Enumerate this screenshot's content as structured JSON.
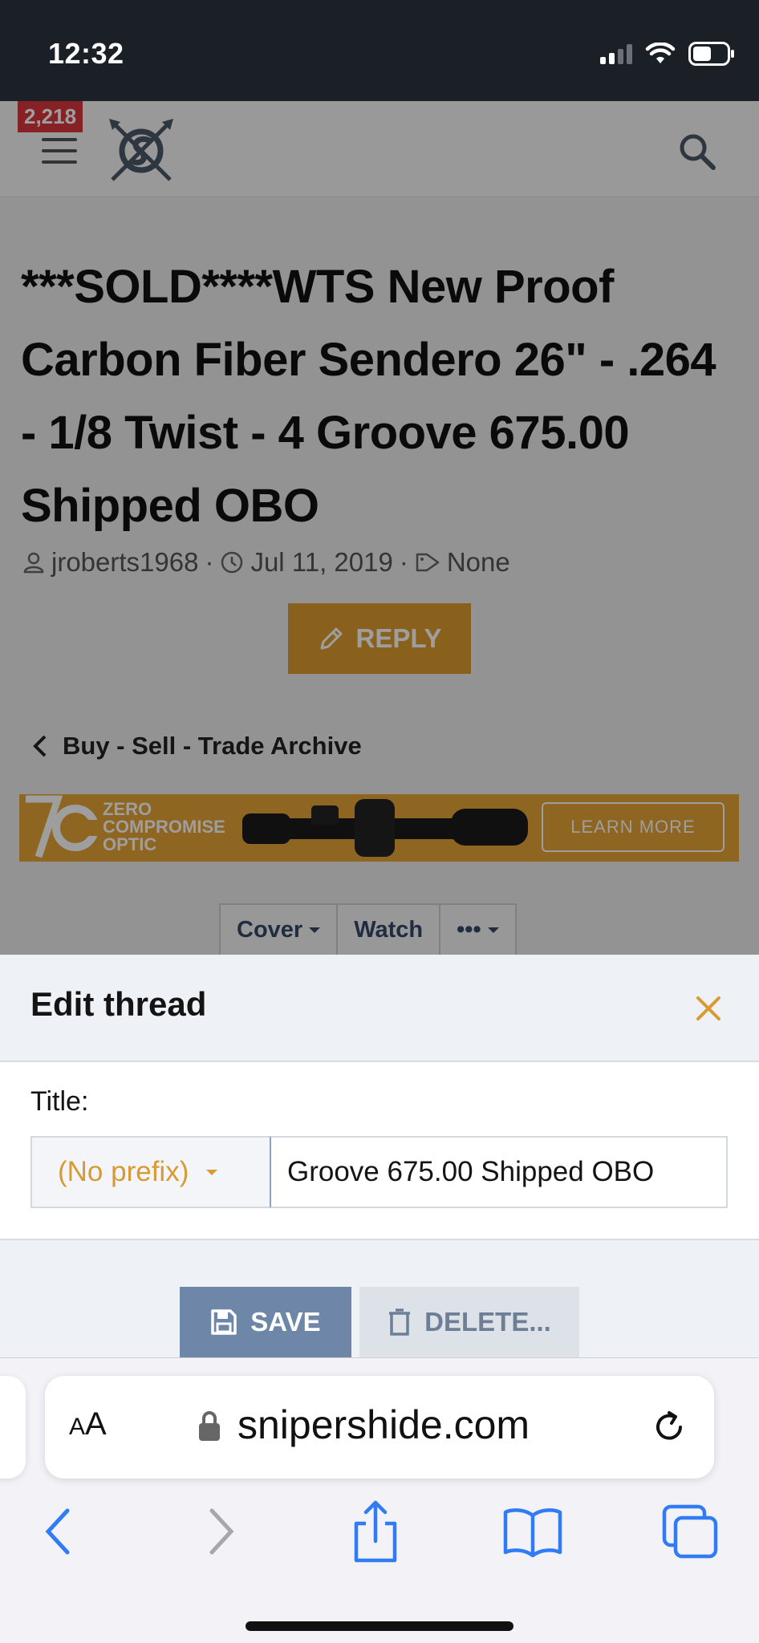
{
  "status": {
    "time": "12:32"
  },
  "header": {
    "notification_count": "2,218"
  },
  "thread": {
    "title": "***SOLD****WTS New Proof Carbon Fiber Sendero 26\" - .264 - 1/8 Twist - 4 Groove 675.00 Shipped OBO",
    "author": "jroberts1968",
    "date": "Jul 11, 2019",
    "tags": "None",
    "reply_label": "REPLY",
    "breadcrumb": "Buy - Sell - Trade Archive"
  },
  "ad": {
    "brand_line1": "ZERO",
    "brand_line2": "COMPROMISE",
    "brand_line3": "OPTIC",
    "cta": "LEARN MORE"
  },
  "thread_actions": {
    "cover": "Cover",
    "watch": "Watch",
    "more": "•••"
  },
  "edit_sheet": {
    "title": "Edit thread",
    "field_label": "Title:",
    "prefix_value": "(No prefix)",
    "title_value": "Groove 675.00 Shipped OBO",
    "save_label": "SAVE",
    "delete_label": "DELETE..."
  },
  "browser": {
    "aa_big": "A",
    "aa_small": "A",
    "url": "snipershide.com"
  },
  "colors": {
    "accent_orange": "#dd9d2e",
    "save_blue": "#6e87a8",
    "badge_red": "#d9363e",
    "ios_blue": "#2f7cf6"
  }
}
